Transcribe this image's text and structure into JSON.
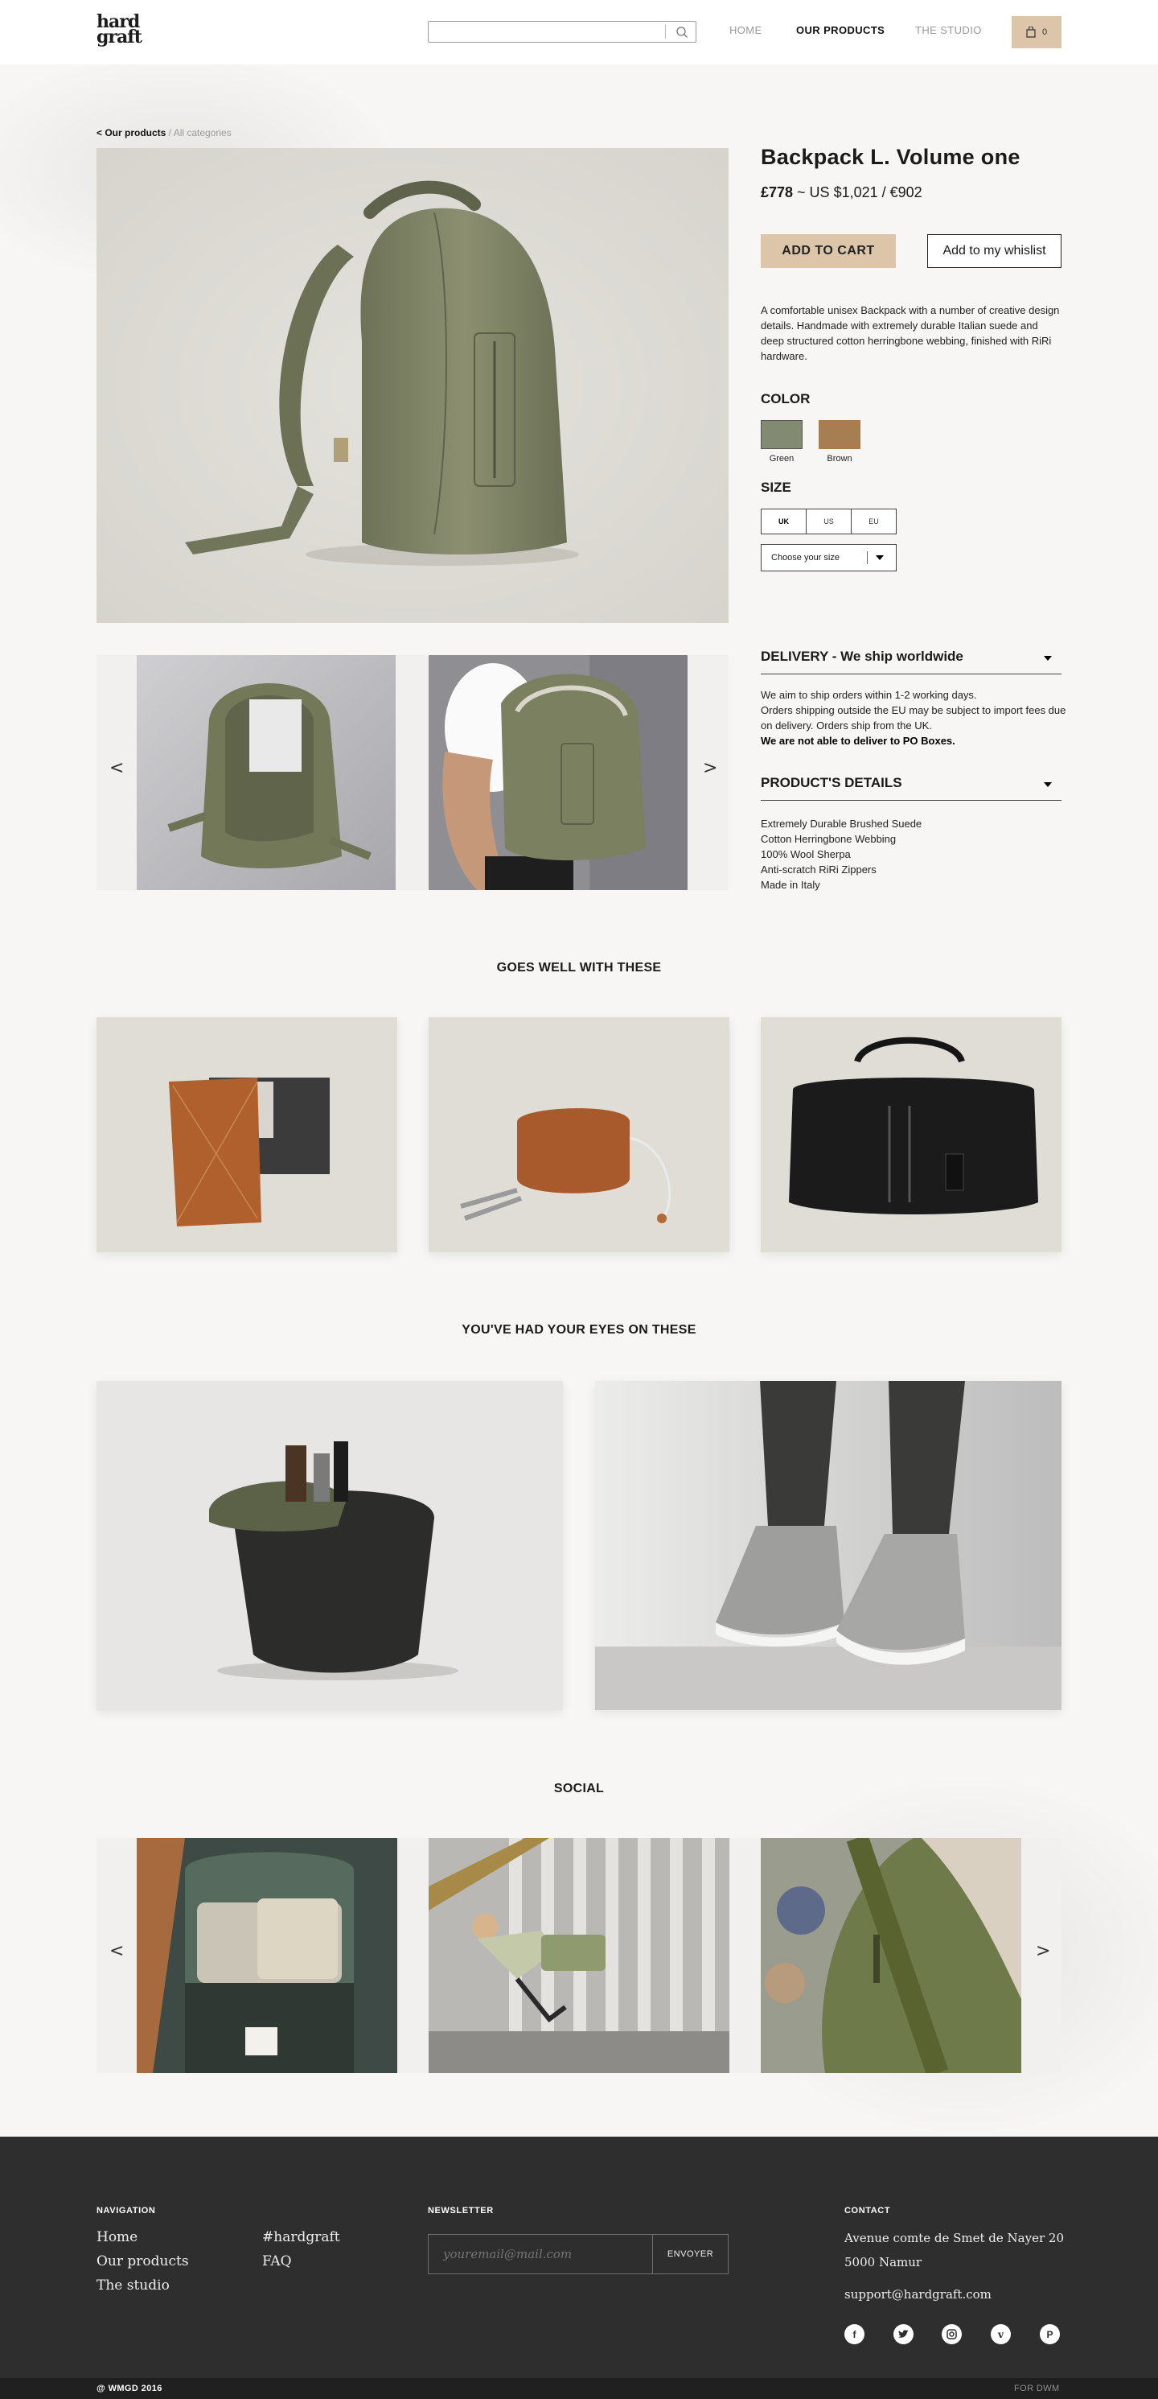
{
  "header": {
    "logo_line1": "hard",
    "logo_line2": "graft",
    "search_placeholder": "",
    "nav": {
      "home": "HOME",
      "products": "OUR PRODUCTS",
      "studio": "THE STUDIO"
    },
    "cart_count": "0"
  },
  "breadcrumb": {
    "link": "< Our products",
    "separator": " / ",
    "current": "All categories"
  },
  "product": {
    "title": "Backpack L. Volume one",
    "price_gbp": "£778",
    "price_other": " ~ US $1,021 / €902",
    "add_to_cart": "ADD TO CART",
    "add_to_wishlist": "Add to my whislist",
    "description": "A comfortable unisex Backpack with a number of creative design details. Handmade with extremely durable Italian suede and deep structured cotton herringbone webbing, finished with RiRi hardware.",
    "color_heading": "COLOR",
    "colors": [
      {
        "label": "Green",
        "hex": "#838a72"
      },
      {
        "label": "Brown",
        "hex": "#a67e52"
      }
    ],
    "size_heading": "SIZE",
    "size_systems": [
      "UK",
      "US",
      "EU"
    ],
    "size_select_placeholder": "Choose your size",
    "delivery_heading": "DELIVERY - We ship worldwide",
    "delivery_lines": [
      "We aim to ship orders within 1-2 working days.",
      "Orders shipping outside the EU may be subject to import fees due on delivery. Orders ship from the UK."
    ],
    "delivery_bold": "We are not able to deliver to PO Boxes.",
    "details_heading": "PRODUCT'S DETAILS",
    "details": [
      "Extremely Durable Brushed Suede",
      "Cotton Herringbone Webbing",
      "100% Wool Sherpa",
      "Anti-scratch RiRi Zippers",
      "Made in Italy"
    ]
  },
  "carousel": {
    "prev": "<",
    "next": ">"
  },
  "sections": {
    "goes_well": "GOES WELL WITH THESE",
    "eyes_on": "YOU'VE HAD YOUR EYES ON THESE",
    "social": "SOCIAL"
  },
  "footer": {
    "nav_heading": "NAVIGATION",
    "nav_links": [
      "Home",
      "Our products",
      "The studio"
    ],
    "extra_links": [
      "#hardgraft",
      "FAQ"
    ],
    "newsletter_heading": "NEWSLETTER",
    "newsletter_placeholder": "youremail@mail.com",
    "newsletter_button": "ENVOYER",
    "contact_heading": "CONTACT",
    "address_line1": "Avenue comte de Smet de Nayer 20",
    "address_line2": "5000 Namur",
    "email": "support@hardgraft.com",
    "social_icons": [
      "facebook-icon",
      "twitter-icon",
      "instagram-icon",
      "vimeo-icon",
      "pinterest-icon"
    ],
    "copyright": "@ WMGD 2016",
    "credits": "FOR DWM"
  },
  "colors": {
    "accent": "#dcc5a9",
    "footer_bg": "#2f2e2e",
    "page_bg": "#f7f6f4"
  }
}
